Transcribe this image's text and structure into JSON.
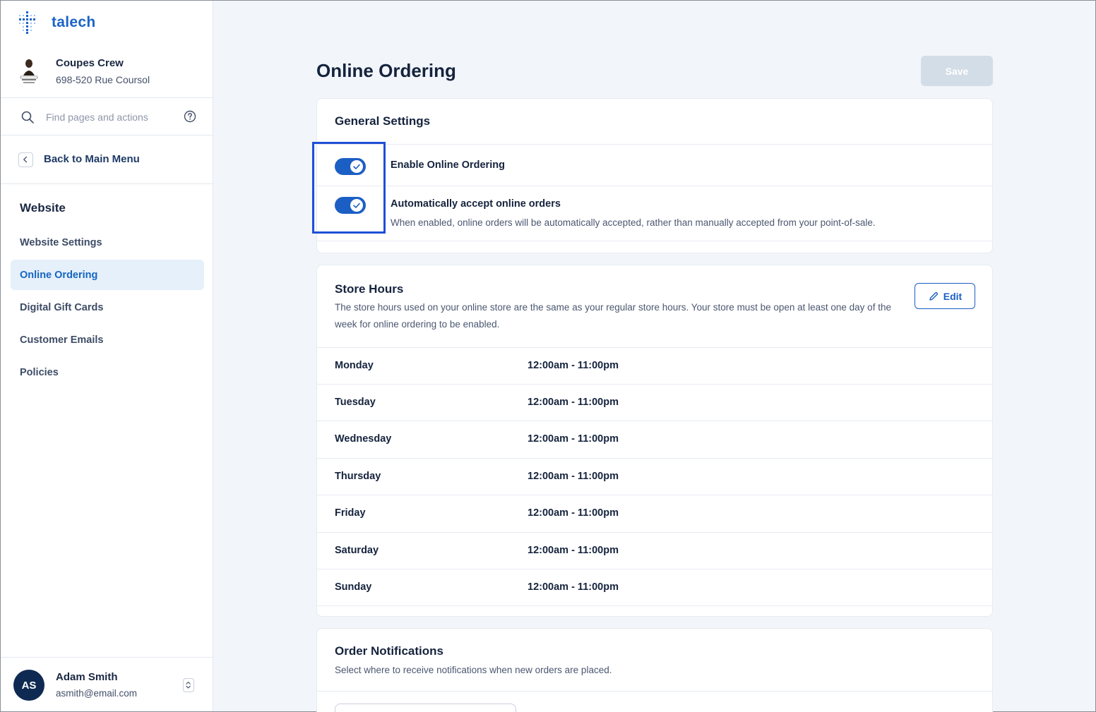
{
  "app": {
    "brand": "talech"
  },
  "store": {
    "name": "Coupes Crew",
    "address": "698-520 Rue Coursol"
  },
  "search": {
    "placeholder": "Find pages and actions"
  },
  "nav": {
    "back_label": "Back to Main Menu",
    "section_title": "Website",
    "items": [
      {
        "label": "Website Settings",
        "active": false
      },
      {
        "label": "Online Ordering",
        "active": true
      },
      {
        "label": "Digital Gift Cards",
        "active": false
      },
      {
        "label": "Customer Emails",
        "active": false
      },
      {
        "label": "Policies",
        "active": false
      }
    ]
  },
  "user": {
    "initials": "AS",
    "name": "Adam Smith",
    "email": "asmith@email.com"
  },
  "page": {
    "title": "Online Ordering",
    "save_label": "Save"
  },
  "general_settings": {
    "title": "General Settings",
    "toggles": [
      {
        "label": "Enable Online Ordering",
        "enabled": true,
        "description": ""
      },
      {
        "label": "Automatically accept online orders",
        "enabled": true,
        "description": "When enabled, online orders will be automatically accepted, rather than manually accepted from your point-of-sale."
      }
    ]
  },
  "store_hours": {
    "title": "Store Hours",
    "description": "The store hours used on your online store are the same as your regular store hours. Your store must be open at least one day of the week for online ordering to be enabled.",
    "edit_label": "Edit",
    "days": [
      {
        "day": "Monday",
        "hours": "12:00am - 11:00pm"
      },
      {
        "day": "Tuesday",
        "hours": "12:00am - 11:00pm"
      },
      {
        "day": "Wednesday",
        "hours": "12:00am - 11:00pm"
      },
      {
        "day": "Thursday",
        "hours": "12:00am - 11:00pm"
      },
      {
        "day": "Friday",
        "hours": "12:00am - 11:00pm"
      },
      {
        "day": "Saturday",
        "hours": "12:00am - 11:00pm"
      },
      {
        "day": "Sunday",
        "hours": "12:00am - 11:00pm"
      }
    ]
  },
  "order_notifications": {
    "title": "Order Notifications",
    "description": "Select where to receive notifications when new orders are placed."
  },
  "colors": {
    "accent": "#1b5fc4",
    "highlight": "#1f4fd6",
    "avatar": "#0f2a52"
  }
}
